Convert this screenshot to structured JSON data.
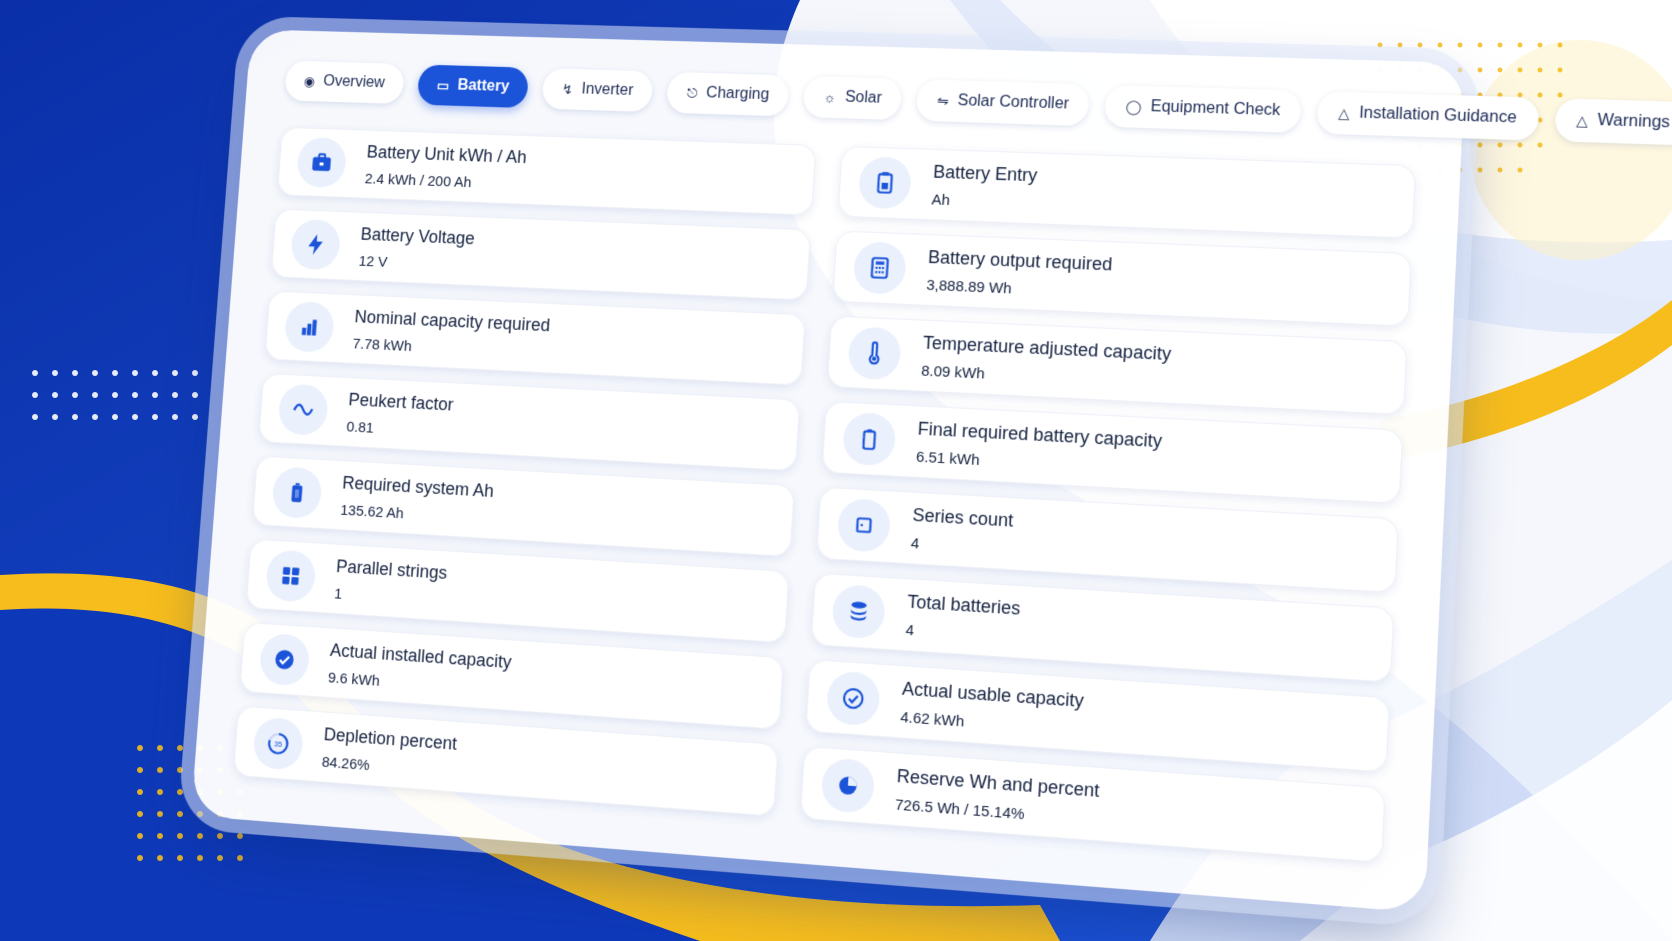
{
  "tabs": [
    {
      "label": "Overview",
      "icon": "eye-icon",
      "active": false
    },
    {
      "label": "Battery",
      "icon": "battery-icon",
      "active": true
    },
    {
      "label": "Inverter",
      "icon": "bolt-icon",
      "active": false
    },
    {
      "label": "Charging",
      "icon": "plug-icon",
      "active": false
    },
    {
      "label": "Solar",
      "icon": "sun-icon",
      "active": false
    },
    {
      "label": "Solar Controller",
      "icon": "controller-icon",
      "active": false
    },
    {
      "label": "Equipment Check",
      "icon": "shield-icon",
      "active": false
    },
    {
      "label": "Installation Guidance",
      "icon": "warning-icon",
      "active": false
    },
    {
      "label": "Warnings",
      "icon": "warning-icon",
      "active": false
    }
  ],
  "cards": {
    "battery_unit": {
      "label": "Battery Unit kWh / Ah",
      "value": "2.4 kWh / 200 Ah",
      "icon": "briefcase-icon"
    },
    "battery_entry": {
      "label": "Battery Entry",
      "value": "Ah",
      "icon": "battery-clipboard-icon"
    },
    "battery_voltage": {
      "label": "Battery Voltage",
      "value": "12 V",
      "icon": "bolt-icon"
    },
    "battery_output": {
      "label": "Battery output required",
      "value": "3,888.89 Wh",
      "icon": "calculator-icon"
    },
    "nominal_capacity": {
      "label": "Nominal capacity required",
      "value": "7.78 kWh",
      "icon": "bar-chart-icon"
    },
    "temp_adjusted": {
      "label": "Temperature adjusted capacity",
      "value": "8.09 kWh",
      "icon": "thermometer-icon"
    },
    "peukert": {
      "label": "Peukert factor",
      "value": "0.81",
      "icon": "wave-icon"
    },
    "final_required": {
      "label": "Final required battery capacity",
      "value": "6.51 kWh",
      "icon": "battery-outline-icon"
    },
    "required_ah": {
      "label": "Required system Ah",
      "value": "135.62 Ah",
      "icon": "battery-full-icon"
    },
    "series_count": {
      "label": "Series count",
      "value": "4",
      "icon": "square-icon"
    },
    "parallel_strings": {
      "label": "Parallel strings",
      "value": "1",
      "icon": "grid-icon"
    },
    "total_batteries": {
      "label": "Total batteries",
      "value": "4",
      "icon": "stack-icon"
    },
    "installed_capacity": {
      "label": "Actual installed capacity",
      "value": "9.6 kWh",
      "icon": "check-circle-filled-icon"
    },
    "usable_capacity": {
      "label": "Actual usable capacity",
      "value": "4.62 kWh",
      "icon": "check-circle-icon"
    },
    "depletion": {
      "label": "Depletion percent",
      "value": "84.26%",
      "icon": "gauge-icon",
      "gauge_text": "35"
    },
    "reserve": {
      "label": "Reserve Wh and percent",
      "value": "726.5 Wh / 15.14%",
      "icon": "pie-icon"
    }
  },
  "colors": {
    "accent": "#1b54d9",
    "brand_blue": "#0c36b8",
    "brand_yellow": "#f7bd1c"
  }
}
